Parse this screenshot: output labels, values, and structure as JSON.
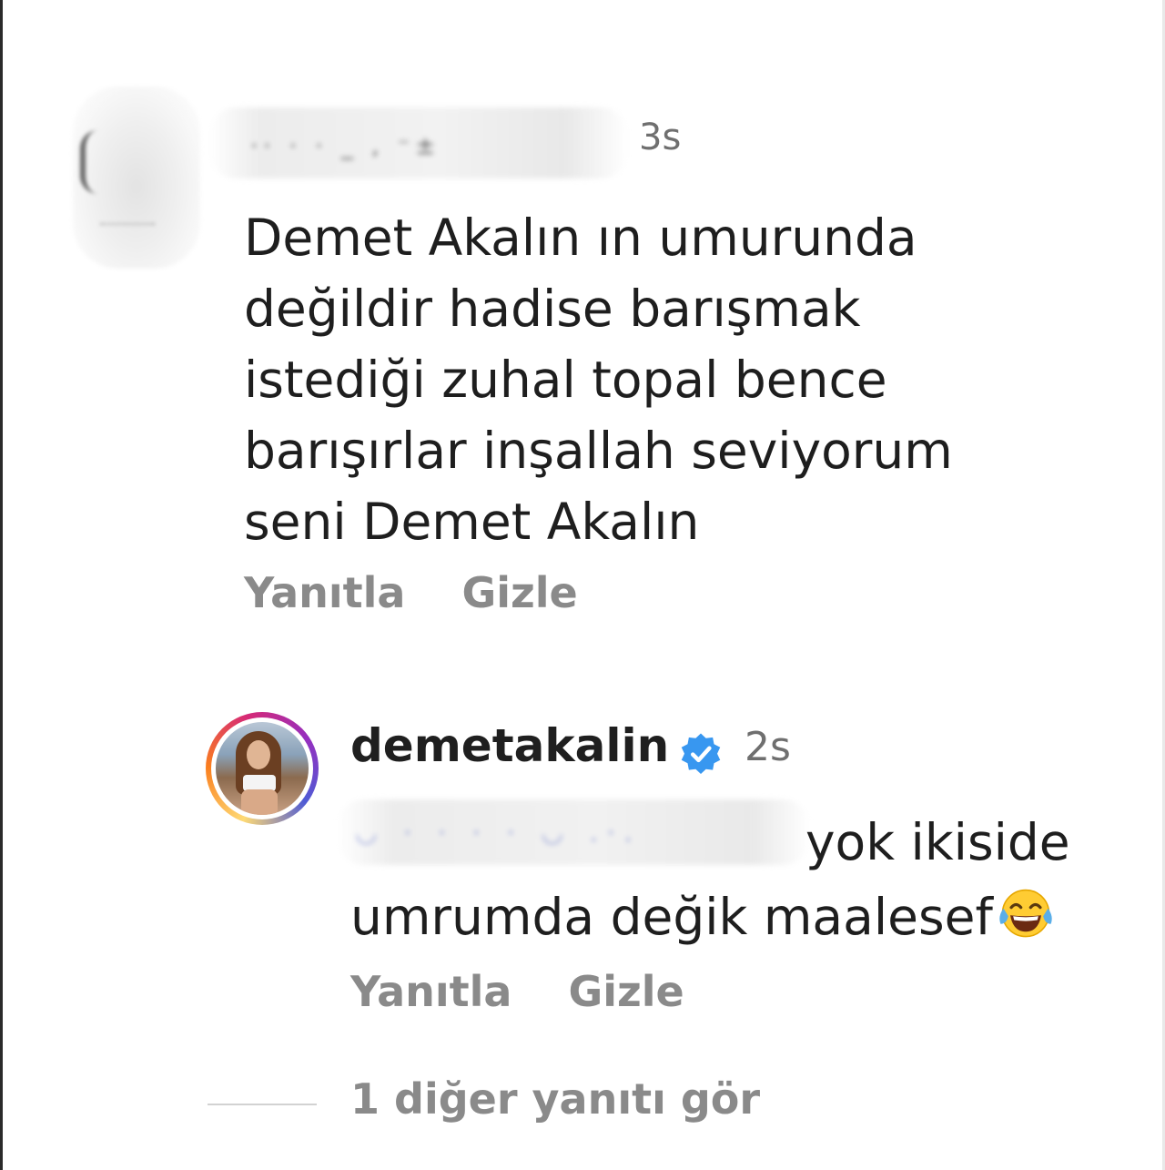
{
  "comment": {
    "time": "3s",
    "text_lines": [
      "Demet Akalın ın umurunda",
      "değildir hadise barışmak",
      "istediği zuhal topal bence",
      "barışırlar inşallah seviyorum",
      "seni Demet Akalın"
    ],
    "reply_label": "Yanıtla",
    "hide_label": "Gizle"
  },
  "reply": {
    "username": "demetakalin",
    "verified": true,
    "time": "2s",
    "text_line1": "yok ikiside",
    "text_line2": "umrumda değik maalesef",
    "emoji": "face-with-tears-of-joy",
    "reply_label": "Yanıtla",
    "hide_label": "Gizle"
  },
  "more_replies": "1 diğer yanıtı gör",
  "colors": {
    "text": "#1e1e1e",
    "secondary": "#8a8a8a",
    "timestamp": "#6f6f6f",
    "verified": "#3897f0",
    "story_ring": [
      "#feda75",
      "#fa7e1e",
      "#d62976",
      "#962fbf",
      "#4f5bd5"
    ]
  }
}
